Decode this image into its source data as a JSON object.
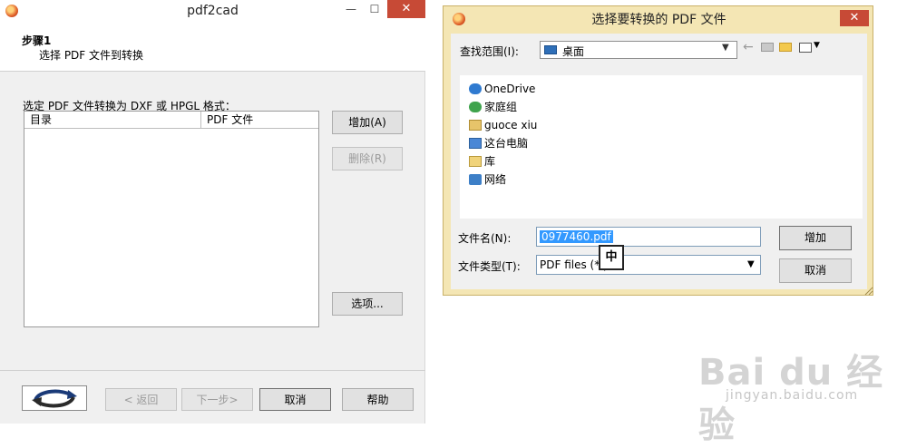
{
  "left_window": {
    "title": "pdf2cad",
    "title_buttons": {
      "minimize": "—",
      "maximize": "☐",
      "close": "✕"
    },
    "step_title": "步骤1",
    "step_desc": "选择 PDF 文件到转换",
    "instruction": "选定 PDF 文件转换为 DXF 或 HPGL 格式：",
    "columns": [
      "目录",
      "PDF 文件"
    ],
    "add_button": "增加(A)",
    "delete_button": "删除(R)",
    "options_button": "选项...",
    "back_button": "< 返回",
    "next_button": "下一步>",
    "cancel_button": "取消",
    "help_button": "帮助"
  },
  "dialog": {
    "title": "选择要转换的 PDF 文件",
    "close": "✕",
    "look_in_label": "查找范围(I):",
    "look_in_value": "桌面",
    "places": [
      {
        "label": "OneDrive",
        "icon": "cloud-icon"
      },
      {
        "label": "家庭组",
        "icon": "homegroup-icon"
      },
      {
        "label": "guoce xiu",
        "icon": "user-folder-icon"
      },
      {
        "label": "这台电脑",
        "icon": "computer-icon"
      },
      {
        "label": "库",
        "icon": "library-icon"
      },
      {
        "label": "网络",
        "icon": "network-icon"
      }
    ],
    "filename_label": "文件名(N):",
    "filename_value": "0977460.pdf",
    "filetype_label": "文件类型(T):",
    "filetype_value": "PDF files (*.p",
    "add_button": "增加",
    "cancel_button": "取消",
    "ime_indicator": "中"
  },
  "watermark": {
    "brand": "Bai du 经验",
    "url": "jingyan.baidu.com"
  },
  "colors": {
    "dialog_frame": "#f4e6b4",
    "close_red": "#c74a36",
    "selection": "#3399ff"
  }
}
